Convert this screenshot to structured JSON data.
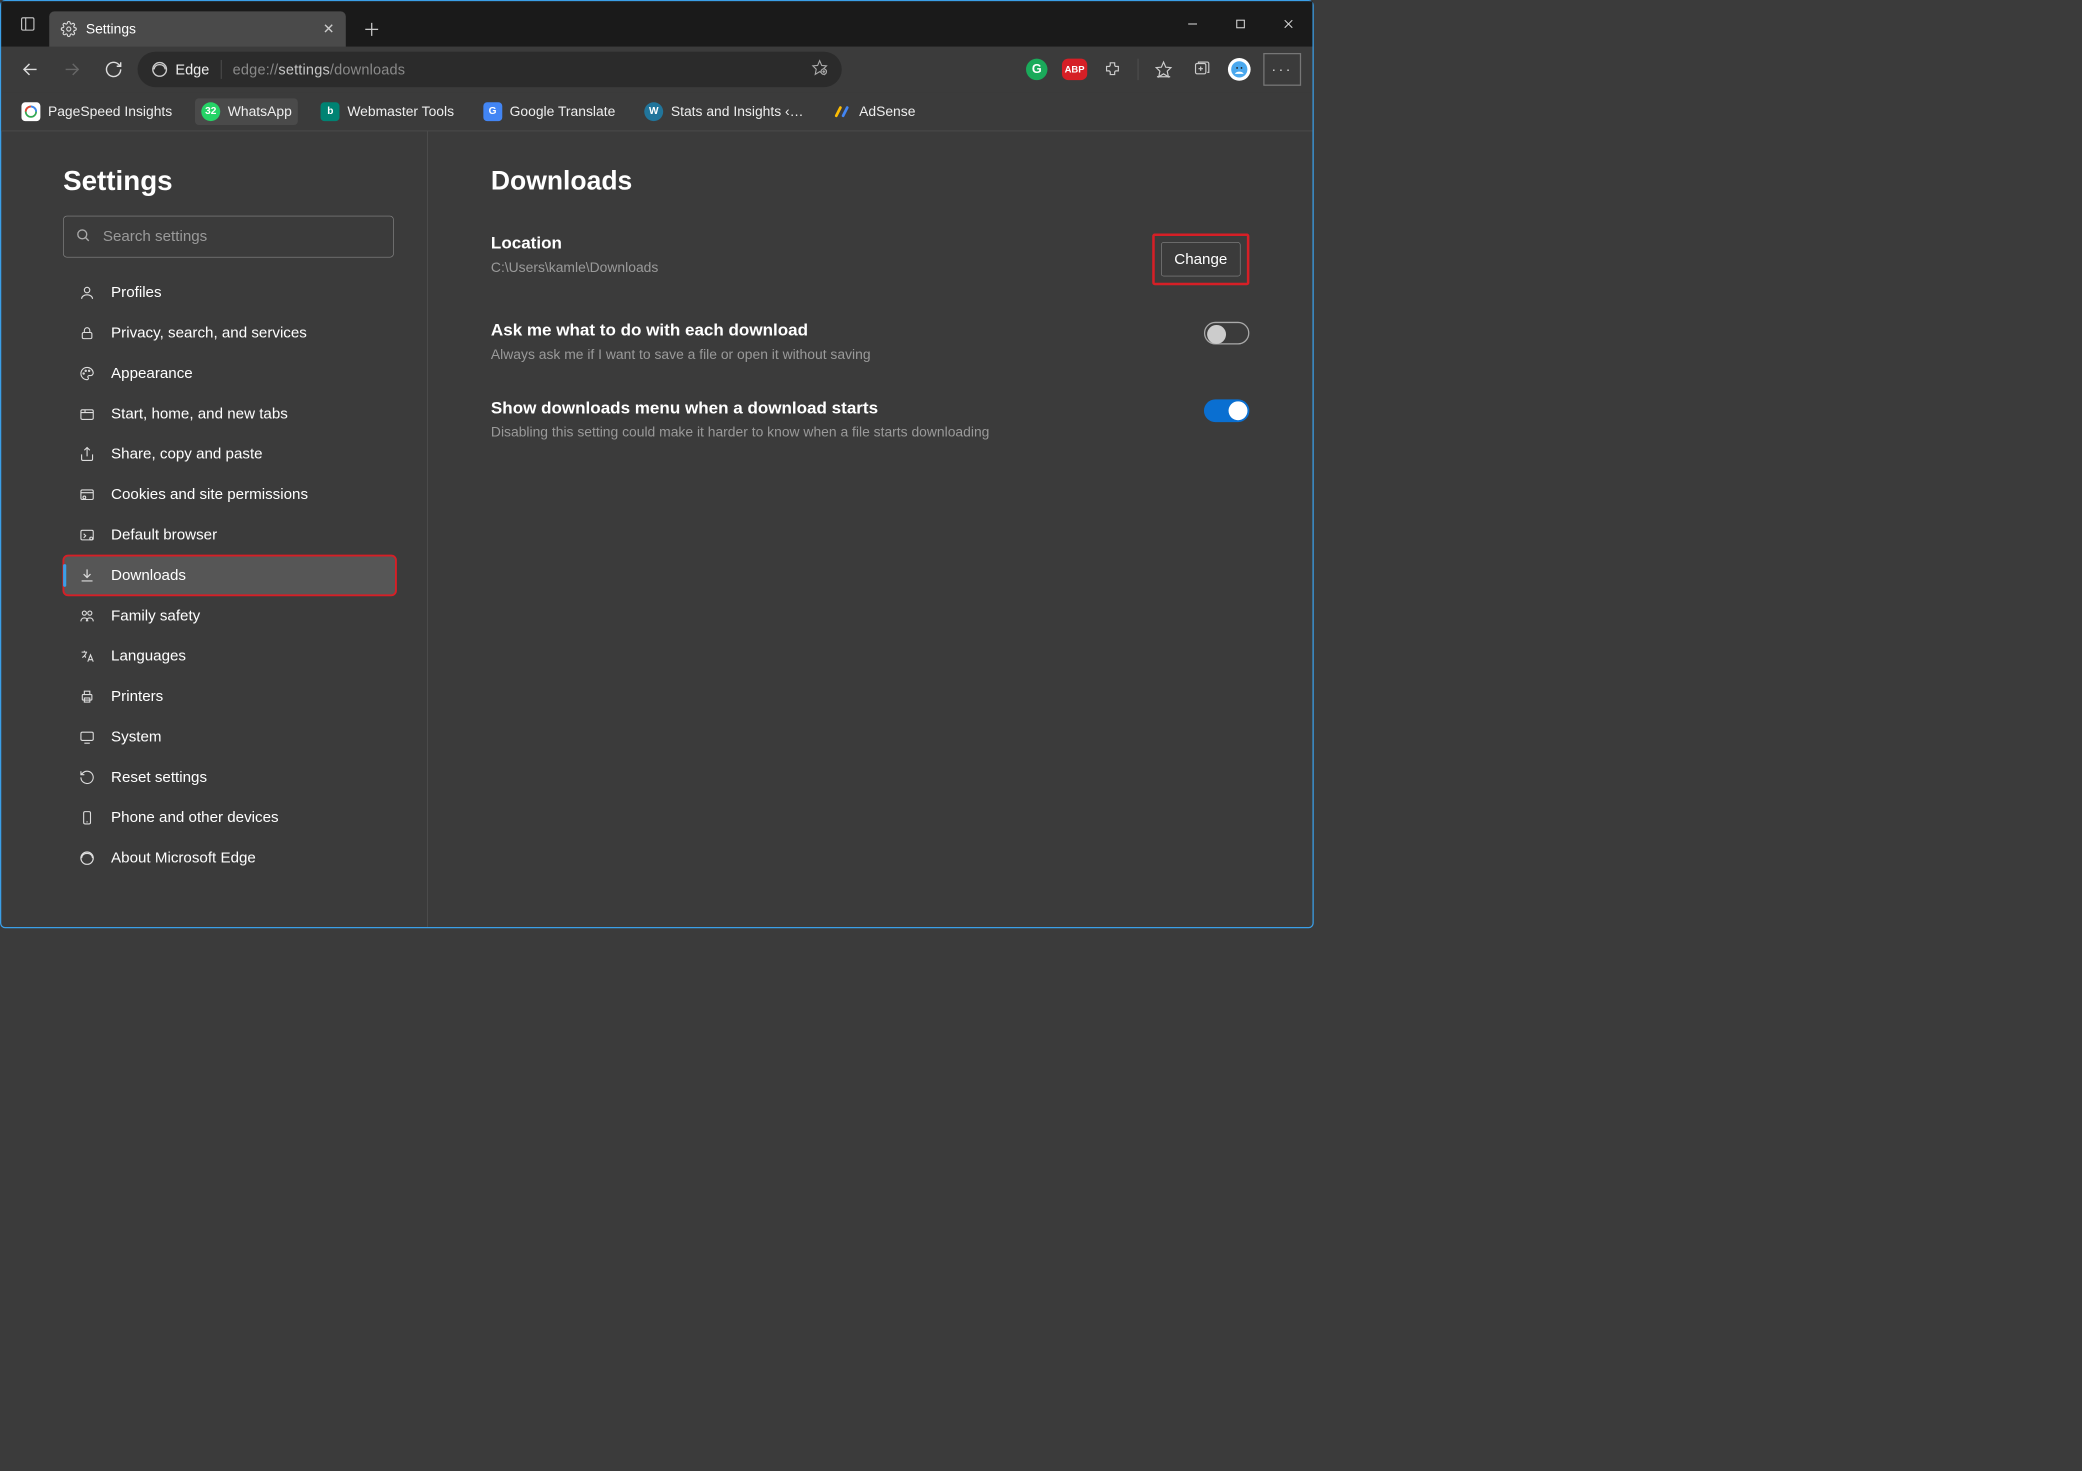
{
  "window": {
    "tab_title": "Settings"
  },
  "addressbar": {
    "brand": "Edge",
    "url_prefix": "edge://",
    "url_mid": "settings",
    "url_suffix": "/downloads"
  },
  "favorites": [
    {
      "label": "PageSpeed Insights"
    },
    {
      "label": "WhatsApp",
      "active": true,
      "badge": "32"
    },
    {
      "label": "Webmaster Tools"
    },
    {
      "label": "Google Translate"
    },
    {
      "label": "Stats and Insights ‹…"
    },
    {
      "label": "AdSense"
    }
  ],
  "sidebar": {
    "heading": "Settings",
    "search_placeholder": "Search settings",
    "items": [
      {
        "label": "Profiles"
      },
      {
        "label": "Privacy, search, and services"
      },
      {
        "label": "Appearance"
      },
      {
        "label": "Start, home, and new tabs"
      },
      {
        "label": "Share, copy and paste"
      },
      {
        "label": "Cookies and site permissions"
      },
      {
        "label": "Default browser"
      },
      {
        "label": "Downloads",
        "selected": true
      },
      {
        "label": "Family safety"
      },
      {
        "label": "Languages"
      },
      {
        "label": "Printers"
      },
      {
        "label": "System"
      },
      {
        "label": "Reset settings"
      },
      {
        "label": "Phone and other devices"
      },
      {
        "label": "About Microsoft Edge"
      }
    ]
  },
  "content": {
    "page_title": "Downloads",
    "location": {
      "title": "Location",
      "path": "C:\\Users\\kamle\\Downloads",
      "change_label": "Change"
    },
    "ask": {
      "title": "Ask me what to do with each download",
      "sub": "Always ask me if I want to save a file or open it without saving",
      "on": false
    },
    "show_menu": {
      "title": "Show downloads menu when a download starts",
      "sub": "Disabling this setting could make it harder to know when a file starts downloading",
      "on": true
    }
  }
}
